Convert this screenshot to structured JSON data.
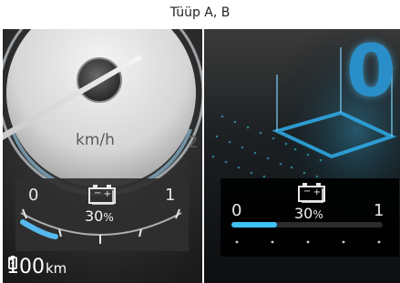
{
  "caption": "Tüüp A, B",
  "panel_a": {
    "speed_unit": "km/h",
    "speed_tick_partial": "2",
    "soc_gauge": {
      "min_label": "0",
      "max_label": "1",
      "percent_value": "30",
      "percent_symbol": "%",
      "level": 0.3
    },
    "range": {
      "value": "100",
      "unit": "km"
    }
  },
  "panel_b": {
    "big_digit": "0",
    "soc_gauge": {
      "min_label": "0",
      "max_label": "1",
      "percent_value": "30",
      "percent_symbol": "%",
      "level": 0.3
    }
  },
  "colors": {
    "accent_blue": "#4cc3f0",
    "cyan_glow": "#3ad0e8"
  }
}
